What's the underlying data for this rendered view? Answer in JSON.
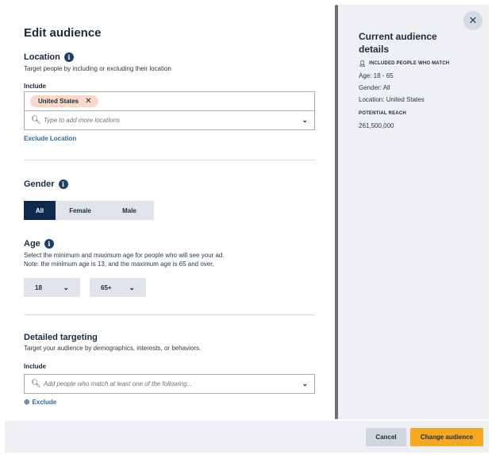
{
  "main": {
    "title": "Edit audience",
    "location": {
      "title": "Location",
      "description": "Target people by including or excluding their location",
      "include_label": "Include",
      "chips": [
        "United States"
      ],
      "placeholder": "Type to add more locations",
      "exclude_link": "Exclude Location"
    },
    "gender": {
      "title": "Gender",
      "options": [
        "All",
        "Female",
        "Male"
      ],
      "selected": "All"
    },
    "age": {
      "title": "Age",
      "description_line1": "Select the minimum and maximum age for people who will see your ad.",
      "description_line2": "Note: the minimum age is 13, and the maximum age is 65 and over.",
      "min": "18",
      "max": "65+"
    },
    "detailed": {
      "title": "Detailed targeting",
      "description": "Target your audience by demographics, interests, or behaviors.",
      "include_label": "Include",
      "placeholder": "Add people who match at least one of the following...",
      "exclude_link": "Exclude"
    }
  },
  "side": {
    "title": "Current audience details",
    "included_head": "INCLUDED PEOPLE WHO MATCH",
    "age_line": "Age: 18 - 65",
    "gender_line": "Gender: All",
    "location_line": "Location: United States",
    "reach_head": "POTENTIAL REACH",
    "reach_value": "261,500,000",
    "close_icon": "close-icon"
  },
  "footer": {
    "cancel_label": "Cancel",
    "change_label": "Change audience"
  },
  "colors": {
    "accent_navy": "#0d2a4c",
    "link_blue": "#2a6a9e",
    "cta_orange": "#f7a823",
    "chip_peach": "#fbd9c9"
  }
}
